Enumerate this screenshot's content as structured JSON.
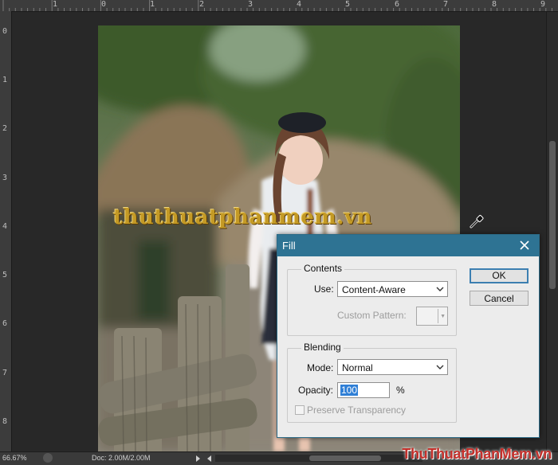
{
  "ruler": {
    "top_labels": [
      "1",
      "0",
      "1",
      "2",
      "3",
      "4",
      "5",
      "6",
      "7",
      "8",
      "9"
    ],
    "left_labels": [
      "0",
      "1",
      "2",
      "3",
      "4",
      "5",
      "6",
      "7",
      "8"
    ]
  },
  "watermark_text": "thuthuatphanmem.vn",
  "brand": "ThuThuatPhanMem.vn",
  "status": {
    "zoom": "66.67%",
    "doc": "Doc: 2.00M/2.00M"
  },
  "dialog": {
    "title": "Fill",
    "contents": {
      "legend": "Contents",
      "use_label": "Use:",
      "use_value": "Content-Aware",
      "custom_pattern_label": "Custom Pattern:"
    },
    "blending": {
      "legend": "Blending",
      "mode_label": "Mode:",
      "mode_value": "Normal",
      "opacity_label": "Opacity:",
      "opacity_value": "100",
      "opacity_unit": "%",
      "preserve_label": "Preserve Transparency",
      "preserve_checked": false
    },
    "ok_label": "OK",
    "cancel_label": "Cancel"
  },
  "colors": {
    "titlebar": "#2e7393",
    "watermark": "#c49a25",
    "brand": "#c4302b",
    "workspace": "#282828"
  },
  "icons": [
    "close-icon",
    "chevron-down-icon",
    "eyedropper-icon",
    "scroll-left-icon",
    "scroll-right-icon",
    "status-menu-icon"
  ]
}
